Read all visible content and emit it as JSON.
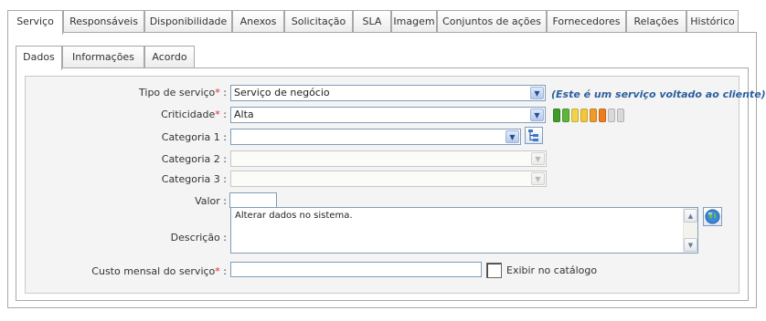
{
  "tabs": [
    {
      "label": "Serviço",
      "active": true
    },
    {
      "label": "Responsáveis"
    },
    {
      "label": "Disponibilidade"
    },
    {
      "label": "Anexos"
    },
    {
      "label": "Solicitação"
    },
    {
      "label": "SLA"
    },
    {
      "label": "Imagem"
    },
    {
      "label": "Conjuntos de ações"
    },
    {
      "label": "Fornecedores"
    },
    {
      "label": "Relações"
    },
    {
      "label": "Histórico"
    }
  ],
  "subtabs": [
    {
      "label": "Dados",
      "active": true
    },
    {
      "label": "Informações"
    },
    {
      "label": "Acordo"
    }
  ],
  "form": {
    "tipo_servico": {
      "label": "Tipo de serviço",
      "required": "*",
      "colon": ":",
      "value": "Serviço de negócio",
      "hint": "(Este é um serviço voltado ao cliente)"
    },
    "criticidade": {
      "label": "Criticidade",
      "required": "*",
      "colon": ":",
      "value": "Alta",
      "level": 6,
      "max_level": 8,
      "colors": [
        "#3f9b2b",
        "#5fb43a",
        "#f2d24a",
        "#f4c63c",
        "#f09a2b",
        "#ee7d1f",
        "#d9d9d9",
        "#d9d9d9"
      ]
    },
    "categoria1": {
      "label": "Categoria 1 :",
      "value": "",
      "tree_icon": "tree-icon"
    },
    "categoria2": {
      "label": "Categoria 2 :",
      "value": ""
    },
    "categoria3": {
      "label": "Categoria 3 :",
      "value": ""
    },
    "valor": {
      "label": "Valor :",
      "value": ""
    },
    "descricao": {
      "label": "Descrição :",
      "value": "Alterar dados no sistema.",
      "globe_icon": "globe-icon"
    },
    "custo": {
      "label": "Custo mensal do serviço",
      "required": "*",
      "colon": ":",
      "value": "",
      "catalog_label": "Exibir no catálogo",
      "catalog_checked": false
    }
  }
}
